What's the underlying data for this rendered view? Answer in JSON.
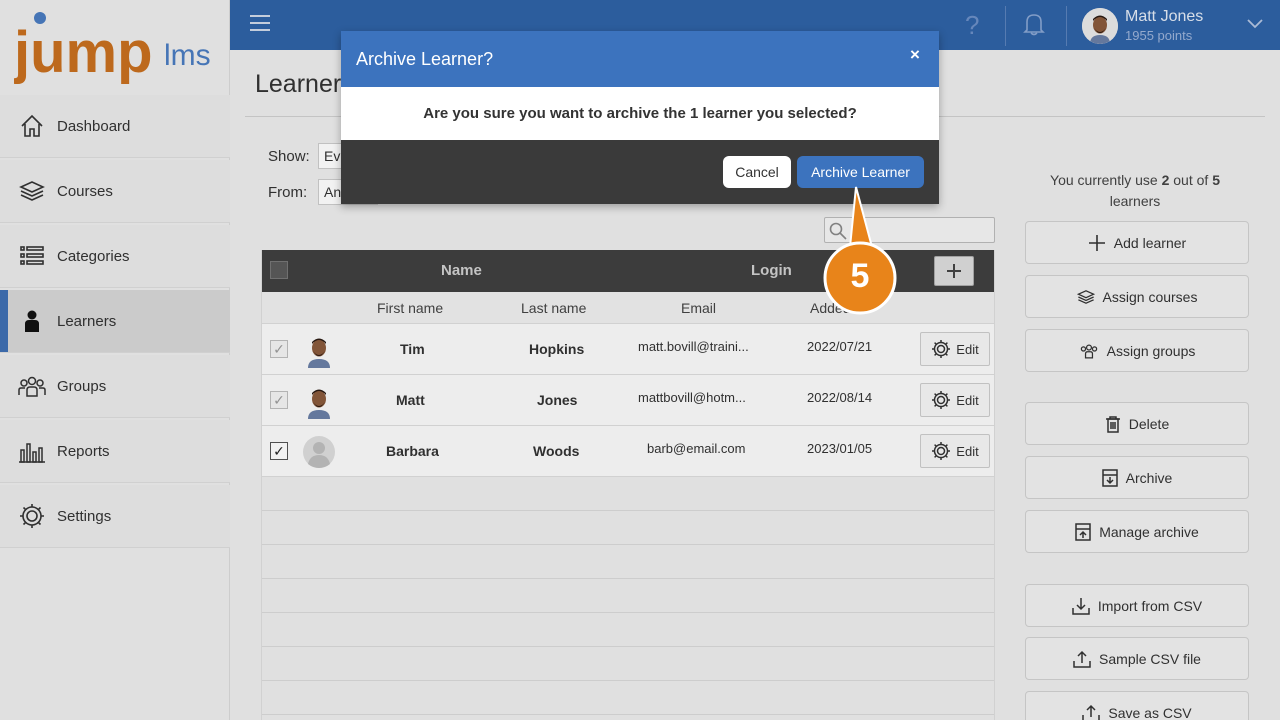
{
  "logo": {
    "main": "jump",
    "suffix": "lms"
  },
  "sidebar": {
    "items": [
      {
        "label": "Dashboard",
        "icon": "home-icon"
      },
      {
        "label": "Courses",
        "icon": "layers-icon"
      },
      {
        "label": "Categories",
        "icon": "list-icon"
      },
      {
        "label": "Learners",
        "icon": "person-icon",
        "active": true
      },
      {
        "label": "Groups",
        "icon": "group-icon"
      },
      {
        "label": "Reports",
        "icon": "bar-chart-icon"
      },
      {
        "label": "Settings",
        "icon": "gear-icon"
      }
    ]
  },
  "header": {
    "help": "?",
    "user_name": "Matt Jones",
    "user_points": "1955 points"
  },
  "main": {
    "title": "Learner",
    "show_label": "Show:",
    "show_value": "Eve",
    "from_label": "From:",
    "from_value": "Any"
  },
  "table": {
    "headers": {
      "name": "Name",
      "login": "Login",
      "add": "+"
    },
    "subheaders": {
      "first": "First name",
      "last": "Last name",
      "email": "Email",
      "added": "Added"
    },
    "rows": [
      {
        "first": "Tim",
        "last": "Hopkins",
        "email": "matt.bovill@traini...",
        "added": "2022/07/21",
        "checked": false
      },
      {
        "first": "Matt",
        "last": "Jones",
        "email": "mattbovill@hotm...",
        "added": "2022/08/14",
        "checked": false
      },
      {
        "first": "Barbara",
        "last": "Woods",
        "email": "barb@email.com",
        "added": "2023/01/05",
        "checked": true
      }
    ],
    "edit_label": "Edit",
    "check_mark": "✓"
  },
  "right_panel": {
    "usage_prefix": "You currently use ",
    "usage_used": "2",
    "usage_mid": " out of ",
    "usage_total": "5",
    "usage_suffix": " learners",
    "buttons": {
      "add_learner": "Add learner",
      "assign_courses": "Assign courses",
      "assign_groups": "Assign groups",
      "delete": "Delete",
      "archive": "Archive",
      "manage_archive": "Manage archive",
      "import_csv": "Import from CSV",
      "sample_csv": "Sample CSV file",
      "save_csv": "Save as CSV"
    }
  },
  "modal": {
    "title": "Archive Learner?",
    "close": "×",
    "msg_prefix": "Are you sure you want to archive the ",
    "msg_count": "1",
    "msg_suffix": " learner you selected?",
    "cancel": "Cancel",
    "confirm": "Archive Learner"
  },
  "callout": {
    "step": "5",
    "color": "#e8841a"
  },
  "colors": {
    "brand_blue": "#2f62a6",
    "modal_blue": "#3c73be",
    "logo_orange": "#c86f1f",
    "logo_blue": "#4a7cc0"
  }
}
